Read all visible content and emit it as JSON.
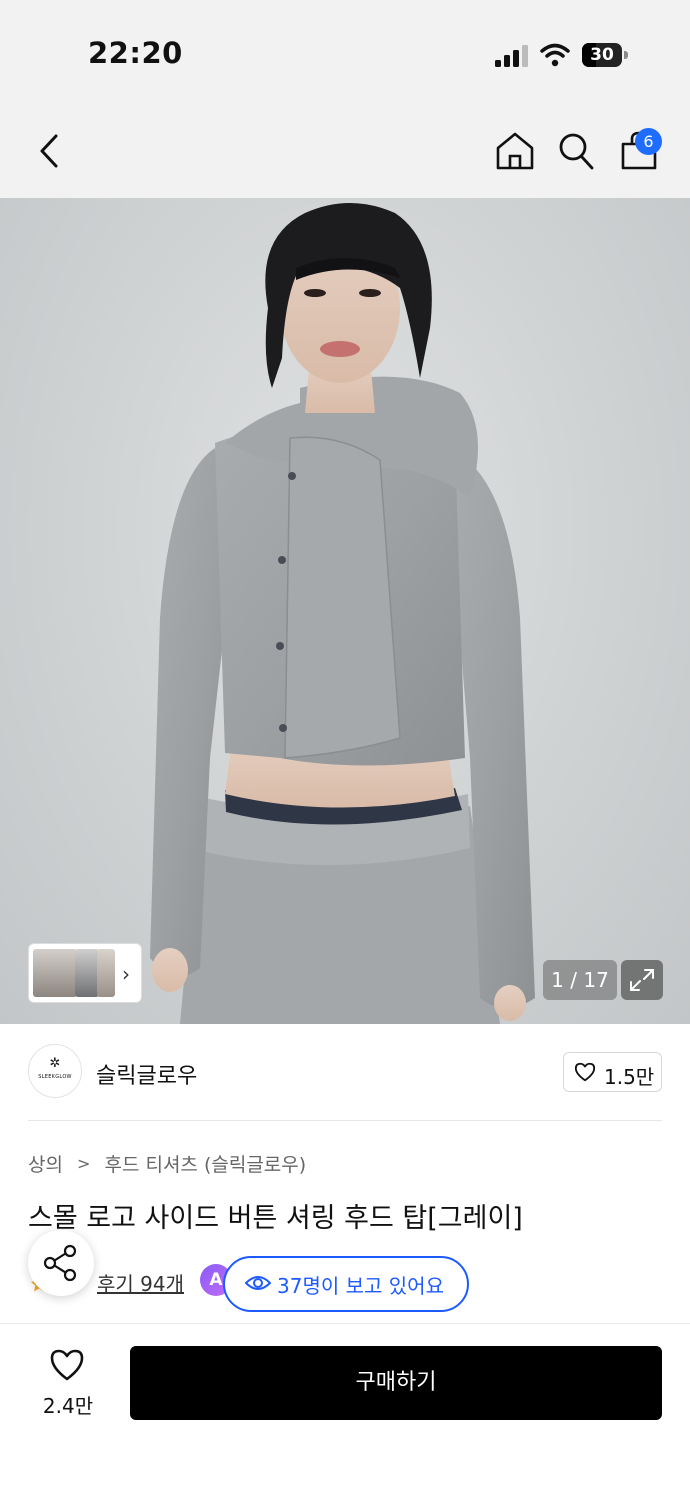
{
  "status_bar": {
    "time": "22:20",
    "battery": "30"
  },
  "header": {
    "cart_count": "6"
  },
  "gallery": {
    "counter": "1 / 17"
  },
  "brand": {
    "logo_text": "SLEEKGLOW",
    "name": "슬릭글로우",
    "likes": "1.5만"
  },
  "breadcrumb": {
    "level1": "상의",
    "separator": ">",
    "level2": "후드 티셔츠 (슬릭글로우)"
  },
  "product": {
    "title": "스몰 로고 사이드 버튼 셔링 후드 탑[그레이]"
  },
  "reviews": {
    "label": "후기 94개",
    "ai_badge": "A",
    "viewers": "37명이 보고 있어요"
  },
  "bottom_bar": {
    "wishlist_count": "2.4만",
    "buy_label": "구매하기"
  },
  "colors": {
    "accent_blue": "#1e5bff",
    "badge_blue": "#1e6dff",
    "buy_button": "#000000"
  }
}
